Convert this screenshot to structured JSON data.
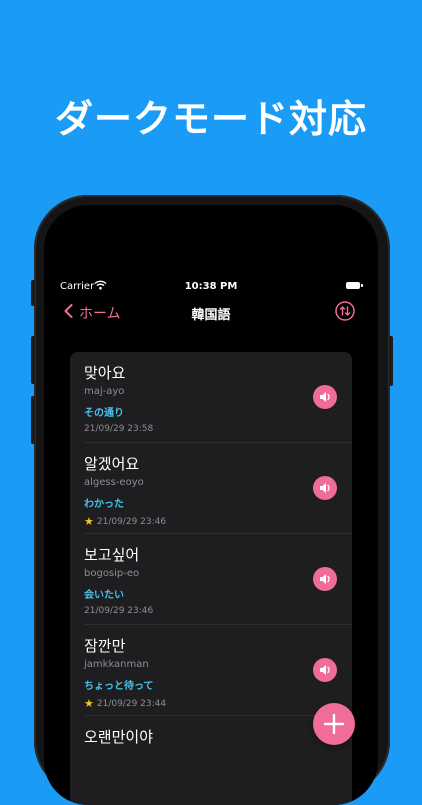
{
  "headline": "ダークモード対応",
  "status_bar": {
    "carrier": "Carrier",
    "time": "10:38 PM"
  },
  "nav": {
    "back_label": "ホーム",
    "title": "韓国語"
  },
  "phrases": [
    {
      "korean": "맞아요",
      "romanization": "maj-ayo",
      "meaning": "その通り",
      "date": "21/09/29 23:58",
      "starred": false
    },
    {
      "korean": "알겠어요",
      "romanization": "algess-eoyo",
      "meaning": "わかった",
      "date": "21/09/29 23:46",
      "starred": true
    },
    {
      "korean": "보고싶어",
      "romanization": "bogosip-eo",
      "meaning": "会いたい",
      "date": "21/09/29 23:46",
      "starred": false
    },
    {
      "korean": "잠깐만",
      "romanization": "jamkkanman",
      "meaning": "ちょっと待って",
      "date": "21/09/29 23:44",
      "starred": true
    },
    {
      "korean": "오랜만이야",
      "romanization": "",
      "meaning": "",
      "date": "",
      "starred": false
    }
  ],
  "icons": {
    "back": "chevron-left-icon",
    "sort": "swap-vertical-icon",
    "speaker": "speaker-icon",
    "add": "plus-icon",
    "star": "star-icon"
  },
  "colors": {
    "background": "#1a9bf5",
    "accent": "#f06c9b",
    "meaning": "#46c3ef",
    "star": "#f7c325",
    "card": "#1e1e20"
  }
}
